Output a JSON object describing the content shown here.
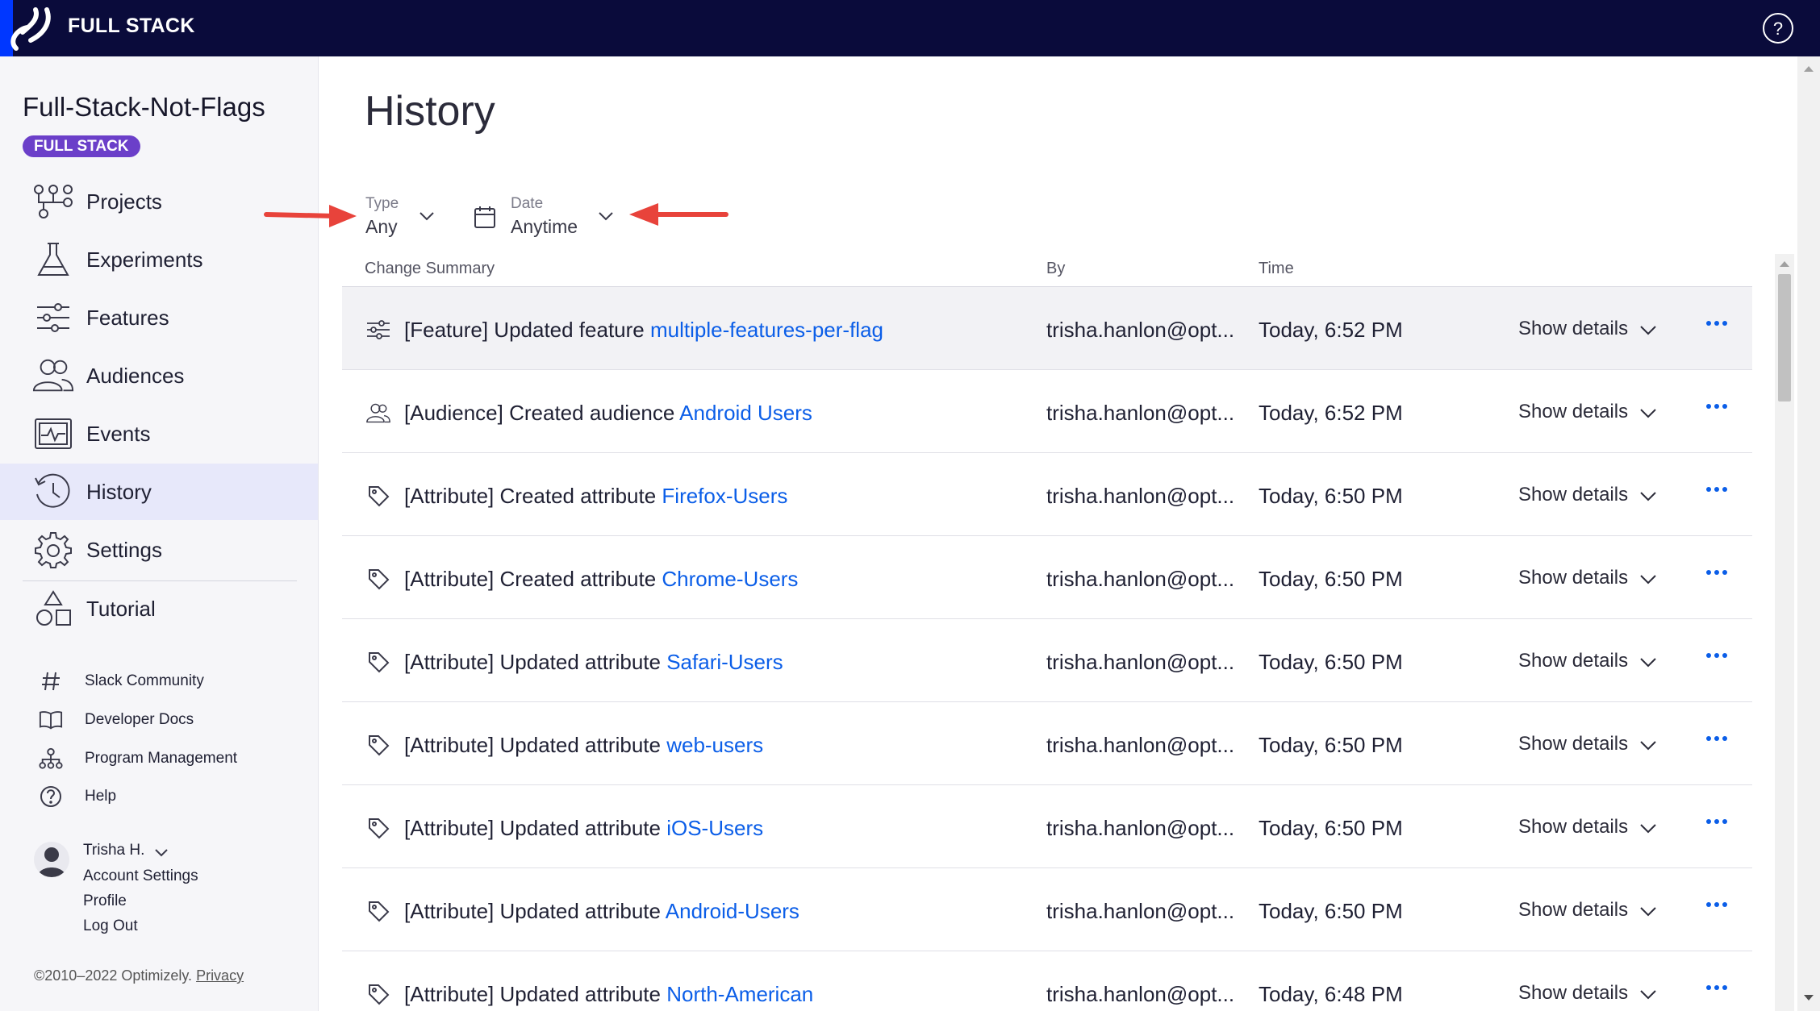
{
  "app": {
    "brand": "FULL STACK"
  },
  "sidebar": {
    "project_title": "Full-Stack-Not-Flags",
    "badge": "FULL STACK",
    "nav": [
      {
        "label": "Projects",
        "icon": "projects-icon"
      },
      {
        "label": "Experiments",
        "icon": "flask-icon"
      },
      {
        "label": "Features",
        "icon": "sliders-icon"
      },
      {
        "label": "Audiences",
        "icon": "users-icon"
      },
      {
        "label": "Events",
        "icon": "events-icon"
      },
      {
        "label": "History",
        "icon": "history-icon",
        "active": true
      },
      {
        "label": "Settings",
        "icon": "gear-icon"
      },
      {
        "label": "Tutorial",
        "icon": "shapes-icon"
      }
    ],
    "resources": [
      {
        "label": "Slack Community",
        "icon": "hash-icon"
      },
      {
        "label": "Developer Docs",
        "icon": "book-icon"
      },
      {
        "label": "Program Management",
        "icon": "org-chart-icon"
      },
      {
        "label": "Help",
        "icon": "help-icon"
      }
    ],
    "user": {
      "name": "Trisha H.",
      "links": [
        "Account Settings",
        "Profile",
        "Log Out"
      ]
    },
    "copyright": "©2010–2022 Optimizely.",
    "privacy": "Privacy"
  },
  "main": {
    "title": "History",
    "filters": {
      "type": {
        "caption": "Type",
        "value": "Any"
      },
      "date": {
        "caption": "Date",
        "value": "Anytime"
      }
    },
    "columns": {
      "summary": "Change Summary",
      "by": "By",
      "time": "Time"
    },
    "rows": [
      {
        "icon": "sliders-icon",
        "prefix": "[Feature]",
        "action": " Updated feature ",
        "link": "multiple-features-per-flag",
        "by": "trisha.hanlon@opt...",
        "time": "Today, 6:52 PM",
        "details": "Show details"
      },
      {
        "icon": "users-icon",
        "prefix": "[Audience]",
        "action": " Created audience ",
        "link": "Android Users",
        "by": "trisha.hanlon@opt...",
        "time": "Today, 6:52 PM",
        "details": "Show details"
      },
      {
        "icon": "tag-icon",
        "prefix": "[Attribute]",
        "action": " Created attribute ",
        "link": "Firefox-Users",
        "by": "trisha.hanlon@opt...",
        "time": "Today, 6:50 PM",
        "details": "Show details"
      },
      {
        "icon": "tag-icon",
        "prefix": "[Attribute]",
        "action": " Created attribute ",
        "link": "Chrome-Users",
        "by": "trisha.hanlon@opt...",
        "time": "Today, 6:50 PM",
        "details": "Show details"
      },
      {
        "icon": "tag-icon",
        "prefix": "[Attribute]",
        "action": " Updated attribute ",
        "link": "Safari-Users",
        "by": "trisha.hanlon@opt...",
        "time": "Today, 6:50 PM",
        "details": "Show details"
      },
      {
        "icon": "tag-icon",
        "prefix": "[Attribute]",
        "action": " Updated attribute ",
        "link": "web-users",
        "by": "trisha.hanlon@opt...",
        "time": "Today, 6:50 PM",
        "details": "Show details"
      },
      {
        "icon": "tag-icon",
        "prefix": "[Attribute]",
        "action": " Updated attribute ",
        "link": "iOS-Users",
        "by": "trisha.hanlon@opt...",
        "time": "Today, 6:50 PM",
        "details": "Show details"
      },
      {
        "icon": "tag-icon",
        "prefix": "[Attribute]",
        "action": " Updated attribute ",
        "link": "Android-Users",
        "by": "trisha.hanlon@opt...",
        "time": "Today, 6:50 PM",
        "details": "Show details"
      },
      {
        "icon": "tag-icon",
        "prefix": "[Attribute]",
        "action": " Updated attribute ",
        "link": "North-American",
        "by": "trisha.hanlon@opt...",
        "time": "Today, 6:48 PM",
        "details": "Show details"
      }
    ]
  },
  "colors": {
    "topbar": "#0a0b3b",
    "logo": "#0037ff",
    "badge": "#6b3fc9",
    "link": "#0b5ee8",
    "annotation_arrow": "#e8433b",
    "active_nav": "#e7e8fa"
  }
}
